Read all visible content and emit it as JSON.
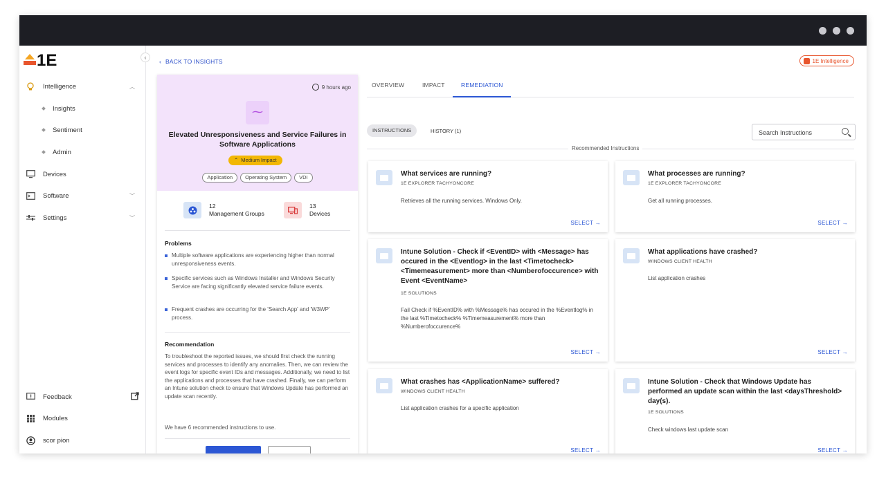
{
  "window": {
    "controls": [
      "dot",
      "dot",
      "dot"
    ]
  },
  "sidebar": {
    "logo": "1E",
    "items": [
      {
        "label": "Intelligence",
        "icon": "bulb-icon"
      },
      {
        "label": "Insights"
      },
      {
        "label": "Sentiment"
      },
      {
        "label": "Admin"
      },
      {
        "label": "Devices",
        "icon": "monitor-icon"
      },
      {
        "label": "Software",
        "icon": "terminal-icon"
      },
      {
        "label": "Settings",
        "icon": "sliders-icon"
      }
    ],
    "bottom": [
      {
        "label": "Feedback",
        "icon": "feedback-icon"
      },
      {
        "label": "Modules",
        "icon": "grid-icon"
      },
      {
        "label": "scor pion",
        "icon": "user-icon"
      }
    ]
  },
  "header": {
    "back_link": "BACK TO INSIGHTS",
    "intelligence_badge": "1E Intelligence"
  },
  "insight": {
    "time_ago": "9 hours ago",
    "title": "Elevated Unresponsiveness and Service Failures in Software Applications",
    "impact": "Medium Impact",
    "tags": [
      "Application",
      "Operating System",
      "VDI"
    ],
    "stats": [
      {
        "count": "12",
        "label": "Management Groups"
      },
      {
        "count": "13",
        "label": "Devices"
      }
    ],
    "problems_heading": "Problems",
    "problems": [
      "Multiple software applications are experiencing higher than normal unresponsiveness events.",
      "Specific services such as Windows Installer and Windows Security Service are facing significantly elevated service failure events.",
      "Frequent crashes are occurring for the 'Search App' and 'W3WP' process."
    ],
    "recommendation_heading": "Recommendation",
    "recommendation": "To troubleshoot the reported issues, we should first check the running services and processes to identify any anomalies. Then, we can review the event logs for specific event IDs and messages. Additionally, we need to list the applications and processes that have crashed. Finally, we can perform an Intune solution check to ensure that Windows Update has performed an update scan recently.",
    "recommendation_count": "We have 6 recommended instructions to use."
  },
  "tabs": [
    "OVERVIEW",
    "IMPACT",
    "REMEDIATION"
  ],
  "active_tab": "REMEDIATION",
  "subtabs": {
    "instructions": "INSTRUCTIONS",
    "history": "HISTORY (1)"
  },
  "search": {
    "placeholder": "Search Instructions"
  },
  "recommended_label": "Recommended Instructions",
  "select_label": "SELECT →",
  "cards": [
    {
      "title": "What services are running?",
      "source": "1E EXPLORER TACHYONCORE",
      "desc": "Retrieves all the running services. Windows Only."
    },
    {
      "title": "What processes are running?",
      "source": "1E EXPLORER TACHYONCORE",
      "desc": "Get all running processes."
    },
    {
      "title": "Intune Solution - Check if <EventID> with <Message> has occured in the <Eventlog> in the last <Timetocheck> <Timemeasurement> more than <Numberofoccurence> with Event <EventName>",
      "source": "1E SOLUTIONS",
      "desc": "Fail Check if %EventID% with %Message% has occured in the %Eventlog% in the last %Timetocheck% %Timemeasurement% more than %Numberofoccurence%"
    },
    {
      "title": "What applications have crashed?",
      "source": "WINDOWS CLIENT HEALTH",
      "desc": "List application crashes"
    },
    {
      "title": "What crashes has <ApplicationName> suffered?",
      "source": "WINDOWS CLIENT HEALTH",
      "desc": "List application crashes for a specific application"
    },
    {
      "title": "Intune Solution - Check that Windows Update has performed an update scan within the last <daysThreshold> day(s).",
      "source": "1E SOLUTIONS",
      "desc": "Check windows last update scan"
    }
  ],
  "colors": {
    "accent": "#2c57d4",
    "impact": "#f2b705",
    "brand_orange": "#e8552d",
    "insight_bg": "#f3e3fb"
  }
}
